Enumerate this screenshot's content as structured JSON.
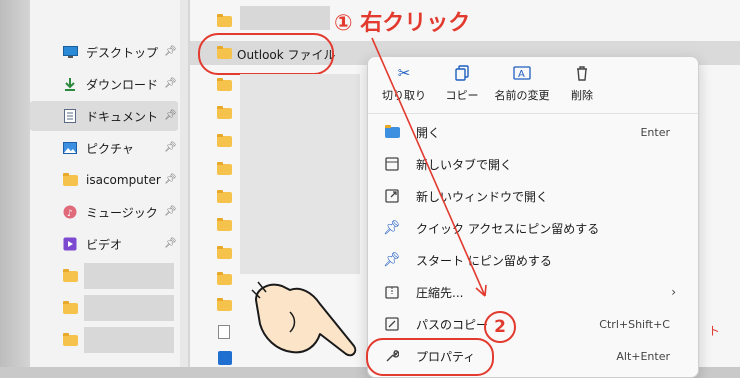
{
  "sidebar": {
    "items": [
      {
        "label": "デスクトップ",
        "icon": "desktop-icon",
        "pinned": true
      },
      {
        "label": "ダウンロード",
        "icon": "download-icon",
        "pinned": true
      },
      {
        "label": "ドキュメント",
        "icon": "document-icon",
        "pinned": true,
        "selected": true
      },
      {
        "label": "ピクチャ",
        "icon": "picture-icon",
        "pinned": true
      },
      {
        "label": "isacomputer",
        "icon": "folder-icon",
        "pinned": true
      },
      {
        "label": "ミュージック",
        "icon": "music-icon",
        "pinned": true
      },
      {
        "label": "ビデオ",
        "icon": "video-icon",
        "pinned": true
      }
    ]
  },
  "files": {
    "selected_name": "Outlook ファイル"
  },
  "annotations": {
    "step1": "① 右クリック",
    "step2": "2"
  },
  "context_menu": {
    "toolbar": [
      {
        "label": "切り取り",
        "icon": "scissors-icon"
      },
      {
        "label": "コピー",
        "icon": "copy-icon"
      },
      {
        "label": "名前の変更",
        "icon": "rename-icon"
      },
      {
        "label": "削除",
        "icon": "trash-icon"
      }
    ],
    "items": [
      {
        "label": "開く",
        "shortcut": "Enter",
        "icon": "open-icon"
      },
      {
        "label": "新しいタブで開く",
        "shortcut": "",
        "icon": "new-tab-icon"
      },
      {
        "label": "新しいウィンドウで開く",
        "shortcut": "",
        "icon": "new-window-icon"
      },
      {
        "label": "クイック アクセスにピン留めする",
        "shortcut": "",
        "icon": "pin-icon"
      },
      {
        "label": "スタート にピン留めする",
        "shortcut": "",
        "icon": "pin-icon"
      },
      {
        "label": "圧縮先...",
        "shortcut": "",
        "icon": "zip-icon",
        "submenu": true
      },
      {
        "label": "パスのコピー",
        "shortcut": "Ctrl+Shift+C",
        "icon": "copy-path-icon"
      },
      {
        "label": "プロパティ",
        "shortcut": "Alt+Enter",
        "icon": "wrench-icon"
      }
    ]
  },
  "colors": {
    "annotation_red": "#e23a2e",
    "accent_blue": "#1f5fbf",
    "folder_yellow": "#f5c24b"
  }
}
